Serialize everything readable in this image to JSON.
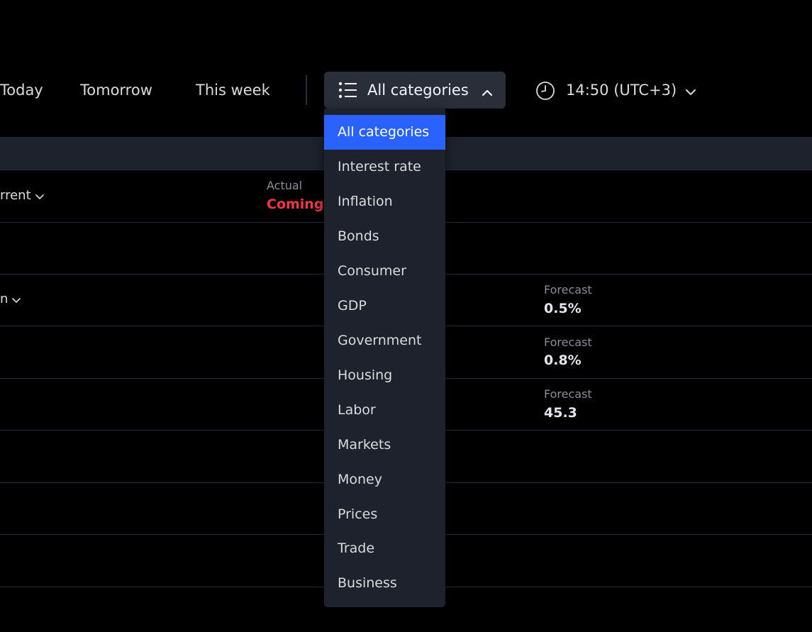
{
  "tabs": {
    "today": "Today",
    "tomorrow": "Tomorrow",
    "this_week": "This week"
  },
  "category_filter": {
    "label": "All categories",
    "icon": "list-icon",
    "expanded": true
  },
  "time_filter": {
    "label": "14:50 (UTC+3)",
    "icon": "clock-icon"
  },
  "table": {
    "row1_label": "rrent",
    "row1_actual_caption": "Actual",
    "row1_actual_value": "Coming",
    "row3_label": "n",
    "forecasts": [
      {
        "caption": "Forecast",
        "value": "0.5%"
      },
      {
        "caption": "Forecast",
        "value": "0.8%"
      },
      {
        "caption": "Forecast",
        "value": "45.3"
      }
    ]
  },
  "dropdown": {
    "items": [
      {
        "label": "All categories",
        "selected": true
      },
      {
        "label": "Interest rate"
      },
      {
        "label": "Inflation"
      },
      {
        "label": "Bonds"
      },
      {
        "label": "Consumer"
      },
      {
        "label": "GDP"
      },
      {
        "label": "Government"
      },
      {
        "label": "Housing"
      },
      {
        "label": "Labor"
      },
      {
        "label": "Markets"
      },
      {
        "label": "Money"
      },
      {
        "label": "Prices"
      },
      {
        "label": "Trade"
      },
      {
        "label": "Business"
      }
    ]
  },
  "colors": {
    "background": "#000000",
    "panel": "#1e222d",
    "accent": "#2962ff",
    "coming": "#f23645"
  }
}
